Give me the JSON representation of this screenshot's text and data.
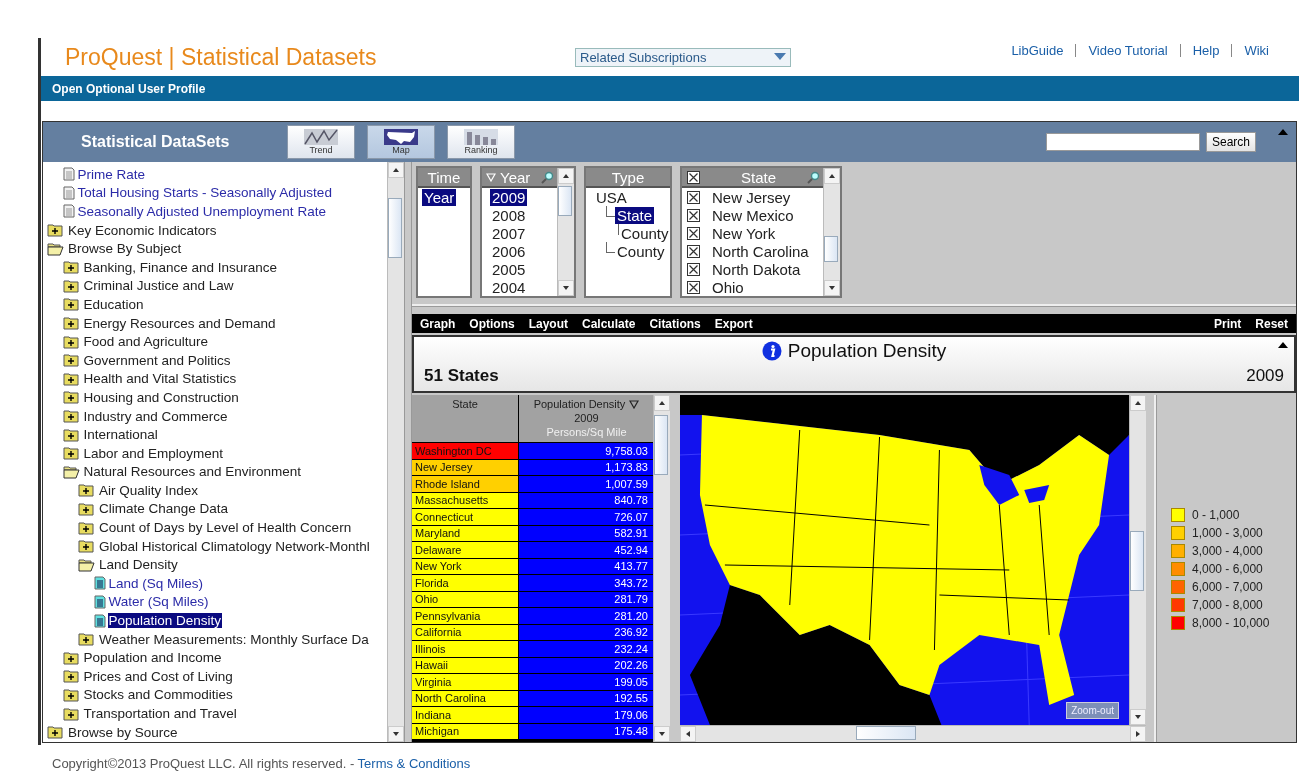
{
  "header": {
    "title": "ProQuest | Statistical Datasets",
    "subscriptions": "Related Subscriptions",
    "links": [
      "LibGuide",
      "Video Tutorial",
      "Help",
      "Wiki"
    ]
  },
  "profile_bar": "Open Optional User Profile",
  "applet": {
    "title": "Statistical DataSets",
    "views": [
      {
        "label": "Trend",
        "kind": "trend",
        "selected": false
      },
      {
        "label": "Map",
        "kind": "map",
        "selected": true
      },
      {
        "label": "Ranking",
        "kind": "ranking",
        "selected": false
      }
    ],
    "search_button": "Search"
  },
  "tree": [
    {
      "children": [
        {
          "label": "Prime Rate",
          "kind": "doc",
          "selected": false
        },
        {
          "label": "Total Housing Starts - Seasonally Adjusted",
          "kind": "doc",
          "selected": false
        },
        {
          "label": "Seasonally Adjusted Unemployment Rate",
          "kind": "doc",
          "selected": false
        }
      ]
    },
    {
      "label": "Key Economic Indicators",
      "kind": "folder",
      "expanded": false,
      "selected": false
    },
    {
      "label": "Browse By Subject",
      "kind": "folder",
      "expanded": true,
      "selected": false,
      "children": [
        {
          "label": "Banking, Finance and Insurance",
          "kind": "folder",
          "expanded": false,
          "selected": false
        },
        {
          "label": "Criminal Justice and Law",
          "kind": "folder",
          "expanded": false,
          "selected": false
        },
        {
          "label": "Education",
          "kind": "folder",
          "expanded": false,
          "selected": false
        },
        {
          "label": "Energy Resources and Demand",
          "kind": "folder",
          "expanded": false,
          "selected": false
        },
        {
          "label": "Food and Agriculture",
          "kind": "folder",
          "expanded": false,
          "selected": false
        },
        {
          "label": "Government and Politics",
          "kind": "folder",
          "expanded": false,
          "selected": false
        },
        {
          "label": "Health and Vital Statistics",
          "kind": "folder",
          "expanded": false,
          "selected": false
        },
        {
          "label": "Housing and Construction",
          "kind": "folder",
          "expanded": false,
          "selected": false
        },
        {
          "label": "Industry and Commerce",
          "kind": "folder",
          "expanded": false,
          "selected": false
        },
        {
          "label": "International",
          "kind": "folder",
          "expanded": false,
          "selected": false
        },
        {
          "label": "Labor and Employment",
          "kind": "folder",
          "expanded": false,
          "selected": false
        },
        {
          "label": "Natural Resources and Environment",
          "kind": "folder",
          "expanded": true,
          "selected": false,
          "children": [
            {
              "label": "Air Quality Index",
              "kind": "folder",
              "expanded": false,
              "selected": false
            },
            {
              "label": "Climate Change Data",
              "kind": "folder",
              "expanded": false,
              "selected": false
            },
            {
              "label": "Count of Days by Level of Health Concern",
              "kind": "folder",
              "expanded": false,
              "selected": false
            },
            {
              "label": "Global Historical Climatology Network-Monthl",
              "kind": "folder",
              "expanded": false,
              "selected": false
            },
            {
              "label": "Land Density",
              "kind": "folder",
              "expanded": true,
              "selected": false,
              "children": [
                {
                  "label": "Land (Sq Miles)",
                  "kind": "dataset",
                  "selected": false
                },
                {
                  "label": "Water (Sq Miles)",
                  "kind": "dataset",
                  "selected": false
                },
                {
                  "label": "Population Density",
                  "kind": "dataset",
                  "selected": true
                }
              ]
            },
            {
              "label": "Weather Measurements: Monthly Surface Da",
              "kind": "folder",
              "expanded": false,
              "selected": false
            }
          ]
        },
        {
          "label": "Population and Income",
          "kind": "folder",
          "expanded": false,
          "selected": false
        },
        {
          "label": "Prices and Cost of Living",
          "kind": "folder",
          "expanded": false,
          "selected": false
        },
        {
          "label": "Stocks and Commodities",
          "kind": "folder",
          "expanded": false,
          "selected": false
        },
        {
          "label": "Transportation and Travel",
          "kind": "folder",
          "expanded": false,
          "selected": false
        }
      ]
    },
    {
      "label": "Browse by Source",
      "kind": "folder",
      "expanded": false,
      "selected": false
    }
  ],
  "selectors": {
    "time": {
      "heading": "Time",
      "items": [
        {
          "label": "Year",
          "selected": true
        }
      ]
    },
    "year": {
      "heading": "Year",
      "items": [
        {
          "label": "2009",
          "selected": true
        },
        {
          "label": "2008",
          "selected": false
        },
        {
          "label": "2007",
          "selected": false
        },
        {
          "label": "2006",
          "selected": false
        },
        {
          "label": "2005",
          "selected": false
        },
        {
          "label": "2004",
          "selected": false
        }
      ]
    },
    "type": {
      "heading": "Type",
      "items": [
        {
          "label": "USA",
          "selected": false,
          "children": [
            {
              "label": "State",
              "selected": true,
              "children": [
                {
                  "label": "County",
                  "selected": false
                }
              ]
            },
            {
              "label": "County",
              "selected": false
            }
          ]
        }
      ]
    },
    "state": {
      "heading": "State",
      "all_checked": true,
      "items": [
        {
          "label": "New Jersey",
          "checked": true
        },
        {
          "label": "New Mexico",
          "checked": true
        },
        {
          "label": "New York",
          "checked": true
        },
        {
          "label": "North Carolina",
          "checked": true
        },
        {
          "label": "North Dakota",
          "checked": true
        },
        {
          "label": "Ohio",
          "checked": true
        }
      ]
    }
  },
  "menu": {
    "left": [
      "Graph",
      "Options",
      "Layout",
      "Calculate",
      "Citations",
      "Export"
    ],
    "right": [
      "Print",
      "Reset"
    ]
  },
  "dataset": {
    "title": "Population Density",
    "count": "51 States",
    "year": "2009"
  },
  "table": {
    "columns": [
      {
        "label": "State"
      },
      {
        "label": "Population Density",
        "year": "2009",
        "unit": "Persons/Sq Mile"
      }
    ],
    "rows": [
      {
        "state": "Washington DC",
        "value": "9,758.03",
        "color": "#ff0000"
      },
      {
        "state": "New Jersey",
        "value": "1,173.83",
        "color": "#ffd000"
      },
      {
        "state": "Rhode Island",
        "value": "1,007.59",
        "color": "#ffd000"
      },
      {
        "state": "Massachusetts",
        "value": "840.78",
        "color": "#ffff00"
      },
      {
        "state": "Connecticut",
        "value": "726.07",
        "color": "#ffff00"
      },
      {
        "state": "Maryland",
        "value": "582.91",
        "color": "#ffff00"
      },
      {
        "state": "Delaware",
        "value": "452.94",
        "color": "#ffff00"
      },
      {
        "state": "New York",
        "value": "413.77",
        "color": "#ffff00"
      },
      {
        "state": "Florida",
        "value": "343.72",
        "color": "#ffff00"
      },
      {
        "state": "Ohio",
        "value": "281.79",
        "color": "#ffff00"
      },
      {
        "state": "Pennsylvania",
        "value": "281.20",
        "color": "#ffff00"
      },
      {
        "state": "California",
        "value": "236.92",
        "color": "#ffff00"
      },
      {
        "state": "Illinois",
        "value": "232.24",
        "color": "#ffff00"
      },
      {
        "state": "Hawaii",
        "value": "202.26",
        "color": "#ffff00"
      },
      {
        "state": "Virginia",
        "value": "199.05",
        "color": "#ffff00"
      },
      {
        "state": "North Carolina",
        "value": "192.55",
        "color": "#ffff00"
      },
      {
        "state": "Indiana",
        "value": "179.06",
        "color": "#ffff00"
      },
      {
        "state": "Michigan",
        "value": "175.48",
        "color": "#ffff00"
      }
    ]
  },
  "map": {
    "kind": "picture",
    "zoom_button": "Zoom-out"
  },
  "legend": [
    {
      "label": "0 - 1,000",
      "color": "#ffff00"
    },
    {
      "label": "1,000 - 3,000",
      "color": "#ffd000"
    },
    {
      "label": "3,000 - 4,000",
      "color": "#ffb000"
    },
    {
      "label": "4,000 - 6,000",
      "color": "#ff8c00"
    },
    {
      "label": "6,000 - 7,000",
      "color": "#ff6400"
    },
    {
      "label": "7,000 - 8,000",
      "color": "#ff3800"
    },
    {
      "label": "8,000 - 10,000",
      "color": "#ff0000"
    }
  ],
  "footer": {
    "text": "Copyright©2013 ProQuest LLC. All rights reserved. -",
    "link": "Terms & Conditions"
  }
}
